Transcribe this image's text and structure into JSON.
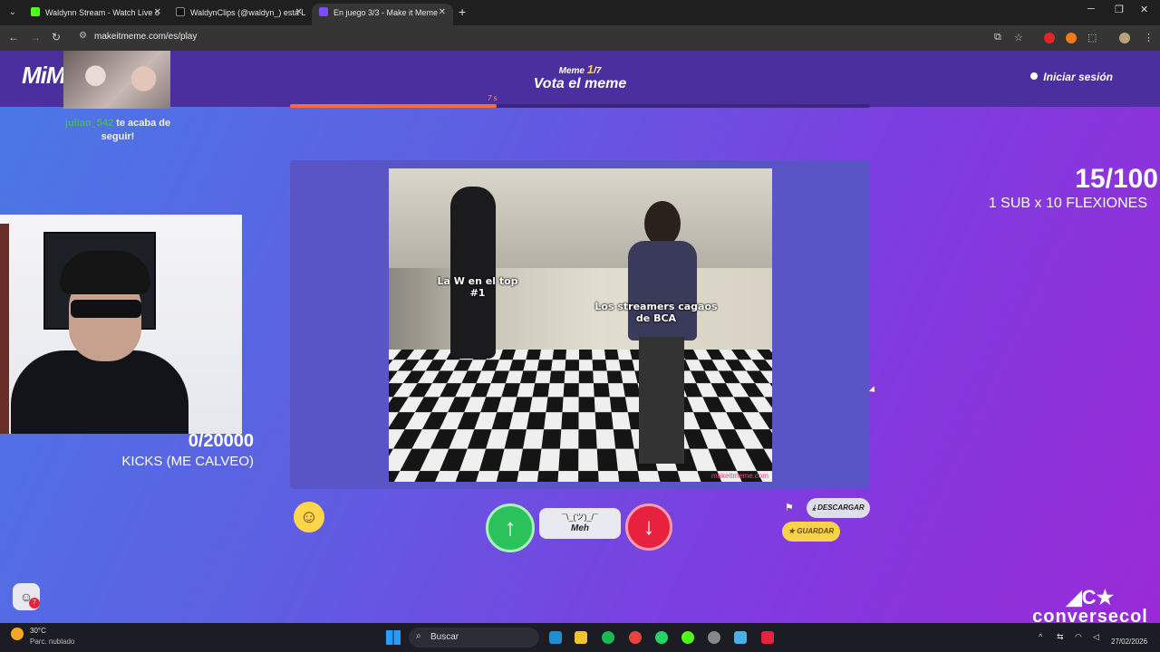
{
  "browser": {
    "tabs": [
      {
        "title": "Waldynn Stream - Watch Live o",
        "active": false,
        "favicon_color": "#53fc18"
      },
      {
        "title": "WaldynClips (@waldyn_) está L",
        "active": false,
        "favicon_color": "#111111"
      },
      {
        "title": "En juego 3/3 - Make it Meme",
        "active": true,
        "favicon_color": "#7b4dff"
      }
    ],
    "url": "makeitmeme.com/es/play"
  },
  "header": {
    "logo": "MiM",
    "meme_label": "Meme",
    "meme_current": "1",
    "meme_total": "/7",
    "title": "Vota el meme",
    "timer": "7 s",
    "progress_fraction": 0.357,
    "login_label": "Iniciar sesión"
  },
  "overlay": {
    "follower_name": "julian_542",
    "follower_text": "te acaba de seguir!",
    "sub_count": "15/100",
    "sub_label": "1 SUB x 10 FLEXIONES",
    "kick_count": "0/20000",
    "kick_label": "KICKS (ME CALVEO)",
    "brand_name": "conversecol"
  },
  "meme": {
    "caption_left": "La W en el top #1",
    "caption_right": "Los streamers cagaos de BCA",
    "watermark": "makeitmeme.com"
  },
  "controls": {
    "upvote_symbol": "↑",
    "meh_face": "¯\\_(ツ)_/¯",
    "meh_label": "Meh",
    "downvote_symbol": "↓",
    "download_label": "DESCARGAR",
    "save_label": "GUARDAR",
    "chat_badge": "7"
  },
  "taskbar": {
    "temperature": "30°C",
    "weather_desc": "Parc. nublado",
    "search_label": "Buscar",
    "date": "27/02/2026"
  },
  "colors": {
    "accent_orange": "#ff6a3a",
    "upvote_green": "#2cc25b",
    "downvote_red": "#e8213f",
    "save_yellow": "#f7d24a"
  }
}
